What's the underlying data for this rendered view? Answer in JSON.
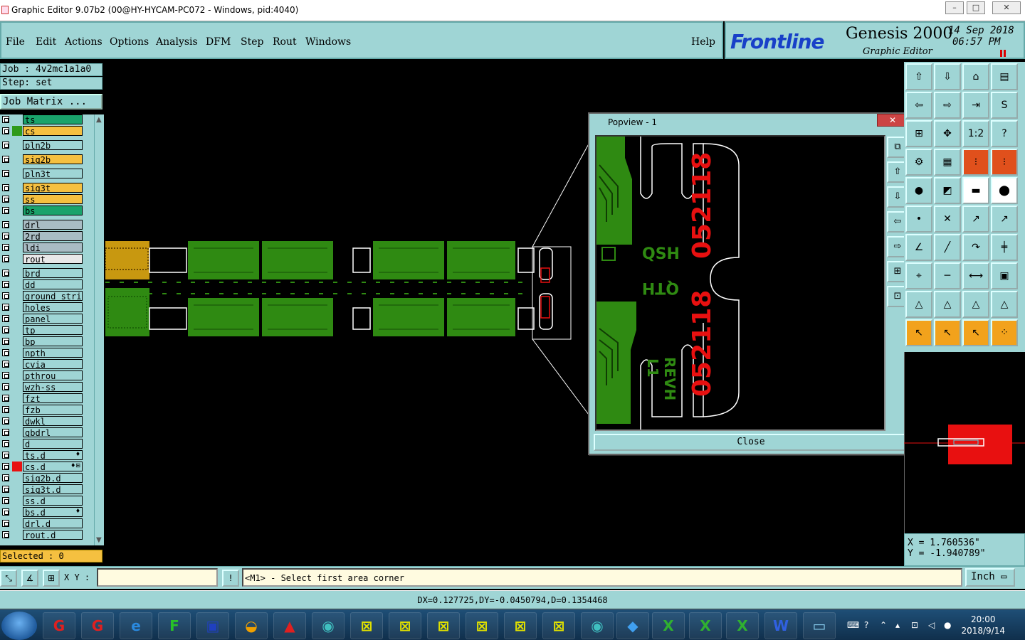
{
  "window": {
    "title": "Graphic Editor 9.07b2 (00@HY-HYCAM-PC072 - Windows, pid:4040)",
    "minimize": "–",
    "maximize": "□",
    "close": "✕"
  },
  "menu": {
    "items": [
      "File",
      "Edit",
      "Actions",
      "Options",
      "Analysis",
      "DFM",
      "Step",
      "Rout",
      "Windows"
    ],
    "help": "Help"
  },
  "brand": {
    "logo": "Frontline",
    "product": "Genesis 2000",
    "subtitle": "Graphic Editor",
    "date": "14 Sep 2018",
    "time": "06:57 PM"
  },
  "left_panel": {
    "job": "Job : 4v2mc1a1a0",
    "step": "Step: set",
    "job_matrix": "Job Matrix ...",
    "selected": "Selected : 0",
    "layers": [
      {
        "name": "ts",
        "color": "#1aa36b",
        "swatch": ""
      },
      {
        "name": "cs",
        "color": "#f5c040",
        "swatch": "#2f9a1a"
      },
      {
        "name": "pln2b",
        "color": "#9fd5d5",
        "swatch": ""
      },
      {
        "name": "sig2b",
        "color": "#f5c040",
        "swatch": ""
      },
      {
        "name": "pln3t",
        "color": "#9fd5d5",
        "swatch": ""
      },
      {
        "name": "sig3t",
        "color": "#f5c040",
        "swatch": ""
      },
      {
        "name": "ss",
        "color": "#f5c040",
        "swatch": ""
      },
      {
        "name": "bs",
        "color": "#1aa36b",
        "swatch": ""
      },
      {
        "name": "drl",
        "color": "#a9bcc4",
        "swatch": ""
      },
      {
        "name": "2rd",
        "color": "#a9bcc4",
        "swatch": ""
      },
      {
        "name": "ldi",
        "color": "#a9bcc4",
        "swatch": ""
      },
      {
        "name": "rout",
        "color": "#e8e8e8",
        "swatch": ""
      },
      {
        "name": "brd",
        "color": "#9fd5d5",
        "swatch": ""
      },
      {
        "name": "dd",
        "color": "#9fd5d5",
        "swatch": ""
      },
      {
        "name": "ground_strip",
        "color": "#9fd5d5",
        "swatch": ""
      },
      {
        "name": "holes",
        "color": "#9fd5d5",
        "swatch": ""
      },
      {
        "name": "panel",
        "color": "#9fd5d5",
        "swatch": ""
      },
      {
        "name": "tp",
        "color": "#9fd5d5",
        "swatch": ""
      },
      {
        "name": "bp",
        "color": "#9fd5d5",
        "swatch": ""
      },
      {
        "name": "npth",
        "color": "#9fd5d5",
        "swatch": ""
      },
      {
        "name": "cvia",
        "color": "#9fd5d5",
        "swatch": ""
      },
      {
        "name": "pthrou",
        "color": "#9fd5d5",
        "swatch": ""
      },
      {
        "name": "wzh-ss",
        "color": "#9fd5d5",
        "swatch": ""
      },
      {
        "name": "fzt",
        "color": "#9fd5d5",
        "swatch": ""
      },
      {
        "name": "fzb",
        "color": "#9fd5d5",
        "swatch": ""
      },
      {
        "name": "dwkl",
        "color": "#9fd5d5",
        "swatch": ""
      },
      {
        "name": "gbdrl",
        "color": "#9fd5d5",
        "swatch": ""
      },
      {
        "name": "d",
        "color": "#9fd5d5",
        "swatch": ""
      },
      {
        "name": "ts.d",
        "color": "#9fd5d5",
        "swatch": "",
        "tag": "♦"
      },
      {
        "name": "cs.d",
        "color": "#9fd5d5",
        "swatch": "#e81010",
        "tag": "♦⊞"
      },
      {
        "name": "sig2b.d",
        "color": "#9fd5d5",
        "swatch": ""
      },
      {
        "name": "sig3t.d",
        "color": "#9fd5d5",
        "swatch": ""
      },
      {
        "name": "ss.d",
        "color": "#9fd5d5",
        "swatch": ""
      },
      {
        "name": "bs.d",
        "color": "#9fd5d5",
        "swatch": "",
        "tag": "♦"
      },
      {
        "name": "drl.d",
        "color": "#9fd5d5",
        "swatch": ""
      },
      {
        "name": "rout.d",
        "color": "#9fd5d5",
        "swatch": ""
      }
    ]
  },
  "popview": {
    "title": "Popview - 1",
    "close_label": "Close",
    "close_x": "✕",
    "board_text": {
      "code1": "052118",
      "code2": "052118",
      "qsh": "QSH",
      "qth": "QTH",
      "rev": "REVH",
      "l1": "L1"
    }
  },
  "coords": {
    "x": "X = 1.760536\"",
    "y": "Y = -1.940789\""
  },
  "bottom": {
    "xy_label": "X Y :",
    "xy_value": "",
    "prompt": "<M1> - Select first area corner",
    "unit": "Inch",
    "status": "DX=0.127725,DY=-0.0450794,D=0.1354468"
  },
  "taskbar": {
    "time": "20:00",
    "date": "2018/9/14"
  },
  "colors": {
    "panel": "#9fd5d5",
    "copper": "#2f8a12",
    "mark_red": "#e81010",
    "gold": "#c89810"
  }
}
